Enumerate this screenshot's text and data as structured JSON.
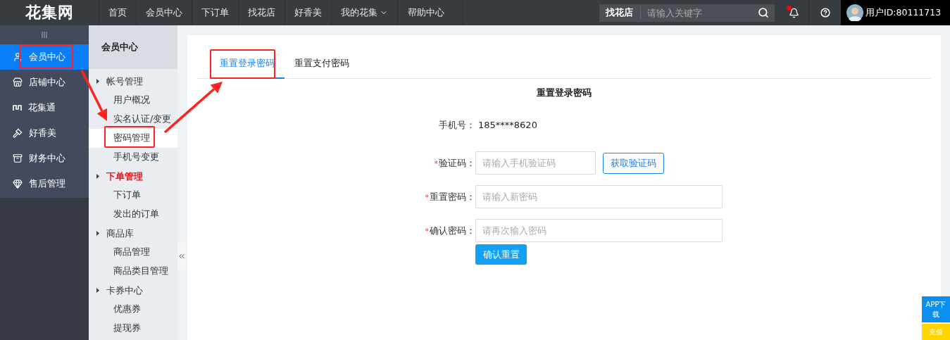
{
  "logo": "花集网",
  "nav": [
    {
      "label": "首页",
      "dropdown": false
    },
    {
      "label": "会员中心",
      "dropdown": false
    },
    {
      "label": "下订单",
      "dropdown": false
    },
    {
      "label": "找花店",
      "dropdown": false
    },
    {
      "label": "好香美",
      "dropdown": false
    },
    {
      "label": "我的花集",
      "dropdown": true
    },
    {
      "label": "帮助中心",
      "dropdown": false
    }
  ],
  "search": {
    "scope": "找花店",
    "placeholder": "请输入关键字"
  },
  "notifications": {
    "unread": true
  },
  "user": {
    "label": "用户ID:80111713"
  },
  "sidebar": {
    "items": [
      {
        "label": "会员中心",
        "selected": true,
        "highlighted": true
      },
      {
        "label": "店铺中心",
        "selected": false,
        "highlighted": false
      },
      {
        "label": "花集通",
        "selected": false,
        "highlighted": false
      },
      {
        "label": "好香美",
        "selected": false,
        "highlighted": false
      },
      {
        "label": "财务中心",
        "selected": false,
        "highlighted": false
      },
      {
        "label": "售后管理",
        "selected": false,
        "highlighted": false
      }
    ]
  },
  "submenu": {
    "title": "会员中心",
    "groups": [
      {
        "label": "帐号管理",
        "active": false,
        "children": [
          {
            "label": "用户概况",
            "selected": false,
            "highlighted": false
          },
          {
            "label": "实名认证/变更",
            "selected": false,
            "highlighted": false
          },
          {
            "label": "密码管理",
            "selected": true,
            "highlighted": true
          },
          {
            "label": "手机号变更",
            "selected": false,
            "highlighted": false
          }
        ]
      },
      {
        "label": "下单管理",
        "active": true,
        "children": [
          {
            "label": "下订单",
            "selected": false,
            "highlighted": false
          },
          {
            "label": "发出的订单",
            "selected": false,
            "highlighted": false
          }
        ]
      },
      {
        "label": "商品库",
        "active": false,
        "children": [
          {
            "label": "商品管理",
            "selected": false,
            "highlighted": false
          },
          {
            "label": "商品类目管理",
            "selected": false,
            "highlighted": false
          }
        ]
      },
      {
        "label": "卡券中心",
        "active": false,
        "children": [
          {
            "label": "优惠券",
            "selected": false,
            "highlighted": false
          },
          {
            "label": "提现券",
            "selected": false,
            "highlighted": false
          }
        ]
      }
    ]
  },
  "tabs": [
    {
      "label": "重置登录密码",
      "selected": true,
      "highlighted": true
    },
    {
      "label": "重置支付密码",
      "selected": false,
      "highlighted": false
    }
  ],
  "form": {
    "title": "重置登录密码",
    "fields": [
      {
        "kind": "text",
        "label": "手机号：",
        "value": "185****8620"
      },
      {
        "kind": "code",
        "required_mark": "*",
        "label": "验证码：",
        "placeholder": "请输入手机验证码",
        "action": "获取验证码"
      },
      {
        "kind": "input",
        "required_mark": "*",
        "label": "重置密码：",
        "placeholder": "请输入新密码"
      },
      {
        "kind": "input",
        "required_mark": "*",
        "label": "确认密码：",
        "placeholder": "请再次输入密码"
      }
    ],
    "submit": "确认重置"
  },
  "floating": [
    {
      "kind": "app",
      "label": "APP下载"
    },
    {
      "kind": "recharge",
      "label": "充值"
    }
  ]
}
